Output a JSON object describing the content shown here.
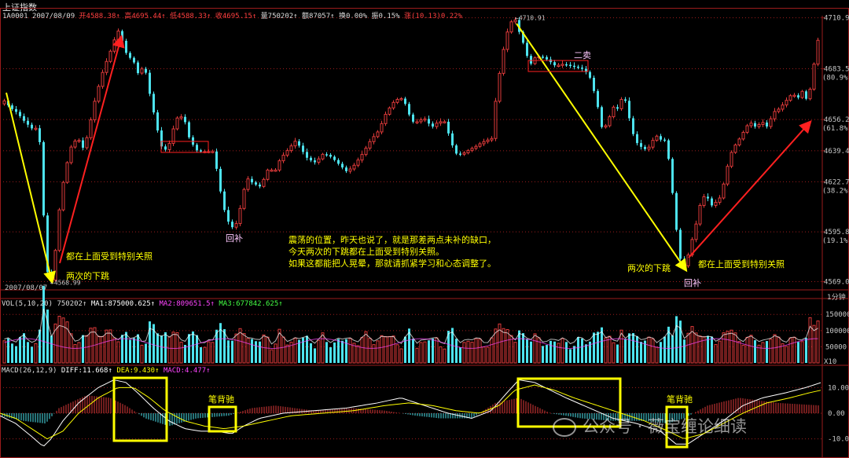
{
  "window": {
    "title": "上证指数",
    "line1": {
      "code": "1A0001",
      "date": "2007/08/09",
      "open": "开4588.38↑",
      "high": "高4695.44↑",
      "low": "低4588.33↑",
      "close": "收4695.15↑",
      "vol": "量750202↑",
      "amount": "额87057↑",
      "turnover": "换0.00%",
      "amplitude": "振0.15%",
      "change": "涨(10.13)0.22%"
    },
    "date_left": "2007/08/07",
    "timeframe": "1分钟",
    "x10": "X10"
  },
  "colors": {
    "up": "#e03a3a",
    "down": "#4de3ee",
    "yellow": "#ffff00",
    "red": "#ff2020",
    "grid": "#9b1c1c",
    "axis_text": "#c8c8c8",
    "magenta": "#ff44ff",
    "white": "#ffffff"
  },
  "chart_data": [
    {
      "type": "candlestick",
      "ylim": [
        4565,
        4712
      ],
      "yticks": [
        {
          "value": 4710.9,
          "label": "4710.9"
        },
        {
          "value": 4683.5,
          "label": "4683.5",
          "sub": "(80.9%)"
        },
        {
          "value": 4656.2,
          "label": "4656.2",
          "sub": "(61.8%)"
        },
        {
          "value": 4639.4,
          "label": "4639.4"
        },
        {
          "value": 4622.7,
          "label": "4622.7",
          "sub": "(38.2%)"
        },
        {
          "value": 4595.8,
          "label": "4595.8",
          "sub": "(19.1%)"
        },
        {
          "value": 4569.0,
          "label": "4569.0"
        }
      ],
      "extremes": {
        "low_label": "4568.99",
        "high_label": "4710.91"
      },
      "price_path": [
        [
          0,
          4663
        ],
        [
          5,
          4667
        ],
        [
          10,
          4663
        ],
        [
          20,
          4660
        ],
        [
          30,
          4655
        ],
        [
          40,
          4651
        ],
        [
          48,
          4652
        ],
        [
          53,
          4612
        ],
        [
          58,
          4575
        ],
        [
          65,
          4569
        ],
        [
          70,
          4590
        ],
        [
          75,
          4612
        ],
        [
          80,
          4625
        ],
        [
          85,
          4635
        ],
        [
          90,
          4643
        ],
        [
          95,
          4645
        ],
        [
          100,
          4645
        ],
        [
          105,
          4640
        ],
        [
          110,
          4648
        ],
        [
          120,
          4668
        ],
        [
          130,
          4683
        ],
        [
          140,
          4694
        ],
        [
          148,
          4704
        ],
        [
          152,
          4703
        ],
        [
          156,
          4694
        ],
        [
          162,
          4690
        ],
        [
          168,
          4688
        ],
        [
          175,
          4680
        ],
        [
          182,
          4686
        ],
        [
          188,
          4672
        ],
        [
          194,
          4660
        ],
        [
          198,
          4652
        ],
        [
          205,
          4640
        ],
        [
          212,
          4640
        ],
        [
          218,
          4650
        ],
        [
          224,
          4657
        ],
        [
          232,
          4658
        ],
        [
          240,
          4645
        ],
        [
          250,
          4639
        ],
        [
          260,
          4639
        ],
        [
          270,
          4639
        ],
        [
          276,
          4625
        ],
        [
          282,
          4610
        ],
        [
          290,
          4600
        ],
        [
          297,
          4597
        ],
        [
          305,
          4610
        ],
        [
          312,
          4625
        ],
        [
          320,
          4622
        ],
        [
          330,
          4620
        ],
        [
          340,
          4630
        ],
        [
          348,
          4628
        ],
        [
          355,
          4635
        ],
        [
          365,
          4640
        ],
        [
          375,
          4645
        ],
        [
          382,
          4640
        ],
        [
          390,
          4635
        ],
        [
          400,
          4633
        ],
        [
          410,
          4638
        ],
        [
          420,
          4636
        ],
        [
          430,
          4632
        ],
        [
          440,
          4628
        ],
        [
          450,
          4632
        ],
        [
          460,
          4638
        ],
        [
          470,
          4645
        ],
        [
          480,
          4650
        ],
        [
          490,
          4660
        ],
        [
          500,
          4666
        ],
        [
          508,
          4668
        ],
        [
          515,
          4664
        ],
        [
          522,
          4655
        ],
        [
          530,
          4655
        ],
        [
          538,
          4657
        ],
        [
          548,
          4652
        ],
        [
          556,
          4655
        ],
        [
          565,
          4655
        ],
        [
          572,
          4644
        ],
        [
          580,
          4637
        ],
        [
          588,
          4638
        ],
        [
          596,
          4640
        ],
        [
          605,
          4642
        ],
        [
          612,
          4644
        ],
        [
          618,
          4645
        ],
        [
          624,
          4646
        ],
        [
          630,
          4670
        ],
        [
          638,
          4692
        ],
        [
          646,
          4707
        ],
        [
          653,
          4711
        ],
        [
          660,
          4702
        ],
        [
          667,
          4694
        ],
        [
          672,
          4685
        ],
        [
          680,
          4690
        ],
        [
          688,
          4690
        ],
        [
          696,
          4688
        ],
        [
          705,
          4685
        ],
        [
          715,
          4686
        ],
        [
          725,
          4685
        ],
        [
          735,
          4684
        ],
        [
          742,
          4683
        ],
        [
          750,
          4678
        ],
        [
          758,
          4665
        ],
        [
          765,
          4650
        ],
        [
          772,
          4655
        ],
        [
          778,
          4663
        ],
        [
          784,
          4662
        ],
        [
          792,
          4670
        ],
        [
          800,
          4655
        ],
        [
          806,
          4645
        ],
        [
          812,
          4642
        ],
        [
          820,
          4640
        ],
        [
          826,
          4642
        ],
        [
          832,
          4648
        ],
        [
          840,
          4645
        ],
        [
          846,
          4645
        ],
        [
          852,
          4625
        ],
        [
          858,
          4600
        ],
        [
          866,
          4575
        ],
        [
          872,
          4580
        ],
        [
          878,
          4590
        ],
        [
          884,
          4600
        ],
        [
          890,
          4612
        ],
        [
          896,
          4616
        ],
        [
          904,
          4610
        ],
        [
          910,
          4612
        ],
        [
          916,
          4615
        ],
        [
          922,
          4628
        ],
        [
          930,
          4640
        ],
        [
          938,
          4645
        ],
        [
          945,
          4650
        ],
        [
          952,
          4655
        ],
        [
          960,
          4652
        ],
        [
          968,
          4655
        ],
        [
          975,
          4652
        ],
        [
          982,
          4660
        ],
        [
          990,
          4662
        ],
        [
          998,
          4666
        ],
        [
          1006,
          4670
        ],
        [
          1014,
          4668
        ],
        [
          1020,
          4672
        ],
        [
          1026,
          4665
        ],
        [
          1032,
          4680
        ],
        [
          1038,
          4698
        ],
        [
          1043,
          4702
        ]
      ],
      "annotations": [
        {
          "text": "都在上面受到特别关照"
        },
        {
          "text": "两次的下跳"
        },
        {
          "text": "回补"
        },
        {
          "text": "震荡的位置，昨天也说了，就是那差两点未补的缺口，"
        },
        {
          "text": "今天两次的下跳都在上面受到特别关照。"
        },
        {
          "text": "如果这都能把人晃晕，那就请抓紧学习和心态调整了。"
        },
        {
          "text": "二卖"
        },
        {
          "text": "两次的下跳"
        },
        {
          "text": "都在上面受到特别关照"
        },
        {
          "text": "回补"
        }
      ]
    },
    {
      "type": "bar",
      "name": "VOL",
      "header": {
        "title": "VOL(5,10,20)",
        "value": "750202↑",
        "ma1": "MA1:875000.625↑",
        "ma2": "MA2:809651.5↑",
        "ma3": "MA3:677842.625↑"
      },
      "ylim": [
        0,
        170000
      ],
      "yticks": [
        {
          "value": 150000,
          "label": "150000"
        },
        {
          "value": 100000,
          "label": "100000"
        },
        {
          "value": 50000,
          "label": "50000"
        }
      ],
      "base": 60000,
      "spikes": [
        [
          58,
          165000
        ],
        [
          1028,
          140000
        ],
        [
          627,
          105000
        ],
        [
          856,
          85000
        ],
        [
          210,
          95000
        ]
      ]
    },
    {
      "type": "macd",
      "header": {
        "title": "MACD(26,12,9)",
        "diff": "DIFF:11.668↑",
        "dea": "DEA:9.430↑",
        "macd": "MACD:4.477↑"
      },
      "ylim": [
        -15,
        15
      ],
      "yticks": [
        {
          "value": 10,
          "label": "10.00"
        },
        {
          "value": 0,
          "label": "0.00"
        },
        {
          "value": -10,
          "label": "-10.00"
        }
      ],
      "diff_path": [
        [
          0,
          -1
        ],
        [
          20,
          -4
        ],
        [
          40,
          -9
        ],
        [
          55,
          -13
        ],
        [
          65,
          -10
        ],
        [
          80,
          -3
        ],
        [
          100,
          4
        ],
        [
          125,
          10
        ],
        [
          145,
          13
        ],
        [
          160,
          12
        ],
        [
          175,
          8
        ],
        [
          195,
          2
        ],
        [
          215,
          -3
        ],
        [
          235,
          -6
        ],
        [
          255,
          -7
        ],
        [
          275,
          -7
        ],
        [
          295,
          -8
        ],
        [
          310,
          -5
        ],
        [
          330,
          -2
        ],
        [
          360,
          0
        ],
        [
          400,
          1
        ],
        [
          440,
          2
        ],
        [
          480,
          4
        ],
        [
          510,
          6
        ],
        [
          540,
          3
        ],
        [
          570,
          0
        ],
        [
          600,
          -2
        ],
        [
          625,
          1
        ],
        [
          645,
          8
        ],
        [
          660,
          13
        ],
        [
          680,
          12
        ],
        [
          700,
          9
        ],
        [
          720,
          6
        ],
        [
          750,
          2
        ],
        [
          780,
          -2
        ],
        [
          810,
          -4
        ],
        [
          840,
          -7
        ],
        [
          860,
          -12
        ],
        [
          875,
          -12
        ],
        [
          895,
          -8
        ],
        [
          920,
          -3
        ],
        [
          945,
          3
        ],
        [
          970,
          6
        ],
        [
          1000,
          8
        ],
        [
          1025,
          10
        ],
        [
          1045,
          12
        ]
      ],
      "dea_path": [
        [
          0,
          0
        ],
        [
          20,
          -2
        ],
        [
          40,
          -6
        ],
        [
          60,
          -10
        ],
        [
          80,
          -7
        ],
        [
          100,
          0
        ],
        [
          125,
          6
        ],
        [
          150,
          10
        ],
        [
          170,
          10
        ],
        [
          190,
          6
        ],
        [
          210,
          1
        ],
        [
          235,
          -3
        ],
        [
          260,
          -5
        ],
        [
          285,
          -6
        ],
        [
          310,
          -5
        ],
        [
          340,
          -3
        ],
        [
          370,
          -1
        ],
        [
          410,
          0
        ],
        [
          450,
          1
        ],
        [
          490,
          3
        ],
        [
          520,
          4
        ],
        [
          550,
          3
        ],
        [
          580,
          1
        ],
        [
          610,
          0
        ],
        [
          635,
          3
        ],
        [
          655,
          9
        ],
        [
          680,
          11
        ],
        [
          705,
          9
        ],
        [
          730,
          6
        ],
        [
          760,
          3
        ],
        [
          790,
          0
        ],
        [
          820,
          -3
        ],
        [
          850,
          -7
        ],
        [
          870,
          -10
        ],
        [
          895,
          -8
        ],
        [
          920,
          -4
        ],
        [
          945,
          0
        ],
        [
          975,
          4
        ],
        [
          1005,
          6
        ],
        [
          1030,
          8
        ],
        [
          1045,
          9
        ]
      ],
      "hist_path": [
        [
          0,
          -1
        ],
        [
          30,
          -3
        ],
        [
          58,
          -4
        ],
        [
          75,
          2
        ],
        [
          110,
          7
        ],
        [
          140,
          6
        ],
        [
          160,
          3
        ],
        [
          185,
          -2
        ],
        [
          215,
          -5
        ],
        [
          250,
          -2
        ],
        [
          290,
          -1
        ],
        [
          320,
          2
        ],
        [
          350,
          3
        ],
        [
          400,
          1
        ],
        [
          450,
          2
        ],
        [
          490,
          1
        ],
        [
          530,
          -1
        ],
        [
          560,
          -2
        ],
        [
          600,
          -2
        ],
        [
          630,
          4
        ],
        [
          660,
          6
        ],
        [
          700,
          0
        ],
        [
          740,
          -2
        ],
        [
          780,
          -3
        ],
        [
          820,
          -3
        ],
        [
          850,
          -4
        ],
        [
          870,
          -2
        ],
        [
          900,
          3
        ],
        [
          940,
          6
        ],
        [
          990,
          4
        ],
        [
          1045,
          3
        ]
      ],
      "annotations": [
        {
          "text": "笔背驰"
        },
        {
          "text": "笔背驰"
        }
      ]
    }
  ],
  "watermark": {
    "text": "公众号 · 薇宝缠论细读"
  }
}
